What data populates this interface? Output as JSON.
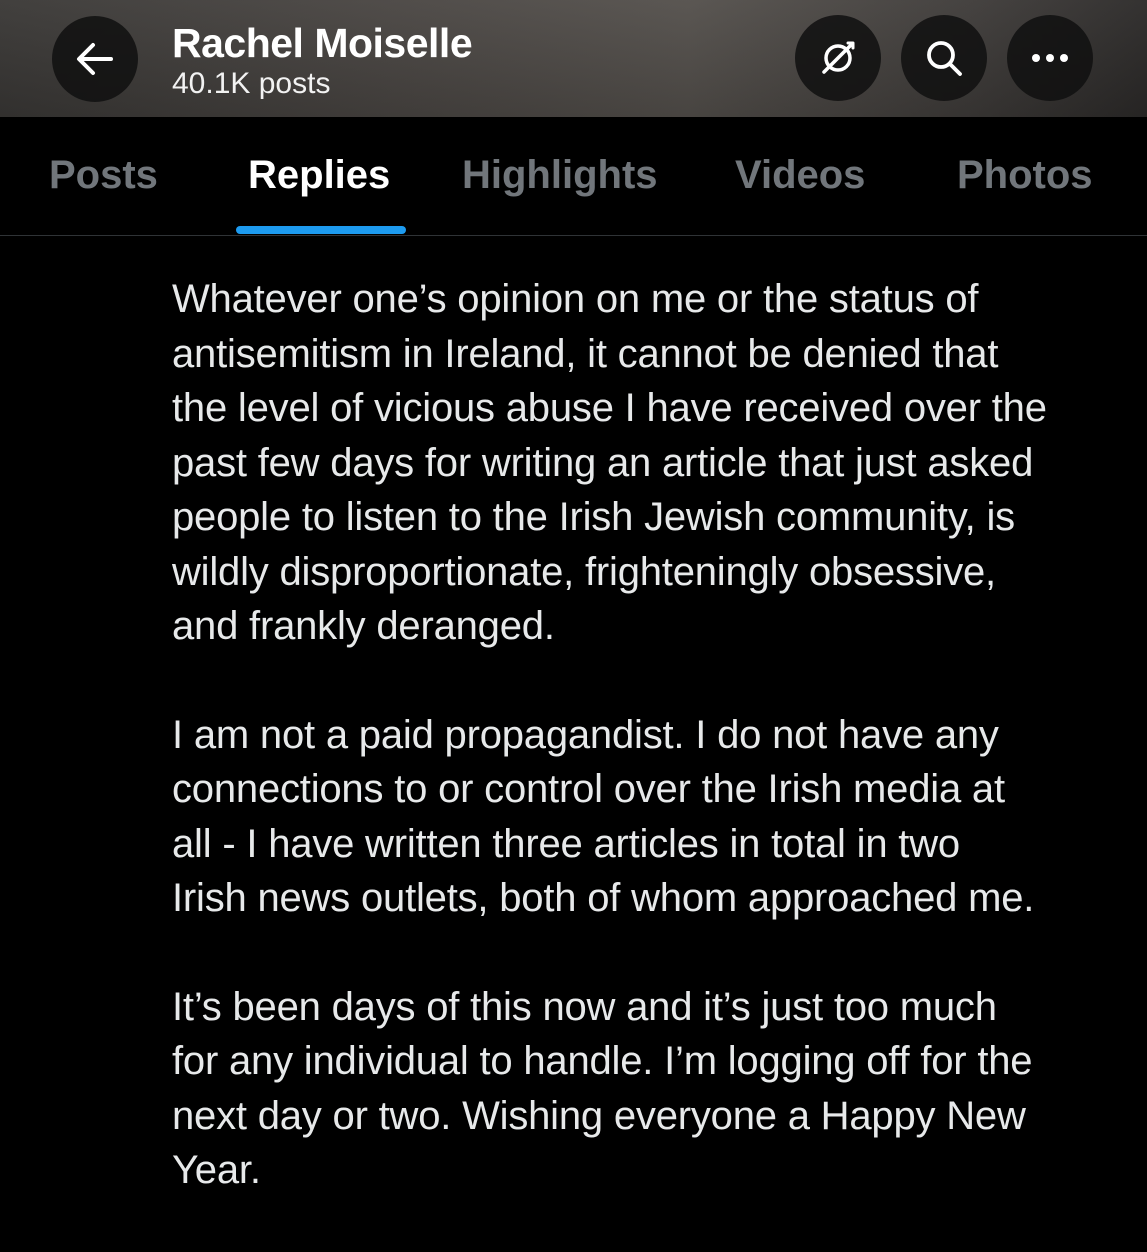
{
  "header": {
    "name": "Rachel Moiselle",
    "post_count": "40.1K posts",
    "icons": {
      "back": "arrow-left-icon",
      "grok": "grok-icon",
      "search": "search-icon",
      "more": "more-horizontal-icon"
    }
  },
  "tabs": [
    {
      "label": "Posts",
      "active": false
    },
    {
      "label": "Replies",
      "active": true
    },
    {
      "label": "Highlights",
      "active": false
    },
    {
      "label": "Videos",
      "active": false
    },
    {
      "label": "Photos",
      "active": false
    }
  ],
  "colors": {
    "accent": "#1d9bf0",
    "text_primary": "#e7e9ea",
    "text_secondary": "#71767b",
    "background": "#000000"
  },
  "post": {
    "paragraphs": [
      "Whatever one’s opinion on me or the status of\nantisemitism in Ireland, it cannot be denied that\nthe level of vicious abuse I have received over the\npast few days for writing an article that just asked\npeople to listen to the Irish Jewish community, is\nwildly disproportionate, frighteningly obsessive,\nand frankly deranged.",
      "I am not a paid propagandist. I do not have any\nconnections to or control over the Irish media at\nall - I have written three articles in total in two\nIrish news outlets, both of whom approached me.",
      "It’s been days of this now and it’s just too much\nfor any individual to handle. I’m logging off for the\nnext day or two. Wishing everyone a Happy New\nYear."
    ]
  }
}
